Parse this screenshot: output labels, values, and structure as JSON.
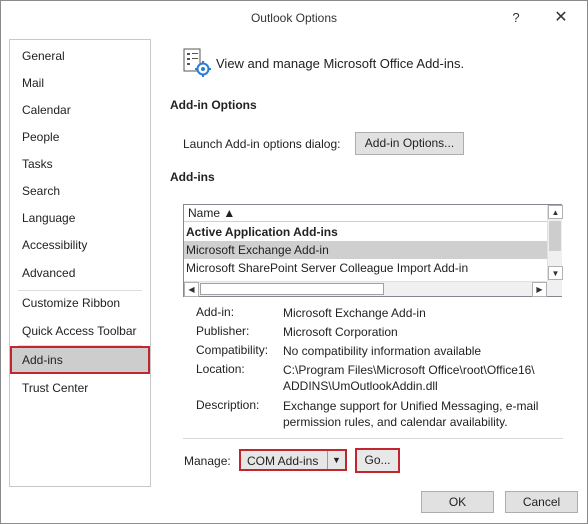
{
  "window": {
    "title": "Outlook Options",
    "help_icon": "question-mark-icon",
    "close_icon": "close-icon"
  },
  "sidebar": {
    "items": [
      {
        "label": "General"
      },
      {
        "label": "Mail"
      },
      {
        "label": "Calendar"
      },
      {
        "label": "People"
      },
      {
        "label": "Tasks"
      },
      {
        "label": "Search"
      },
      {
        "label": "Language"
      },
      {
        "label": "Accessibility"
      },
      {
        "label": "Advanced"
      },
      {
        "label": "Customize Ribbon"
      },
      {
        "label": "Quick Access Toolbar"
      },
      {
        "label": "Add-ins",
        "selected": true
      },
      {
        "label": "Trust Center"
      }
    ]
  },
  "main": {
    "header_icon": "addins-gear-icon",
    "header_text": "View and manage Microsoft Office Add-ins.",
    "addin_options": {
      "section_title": "Add-in Options",
      "launch_label": "Launch Add-in options dialog:",
      "button_label": "Add-in Options..."
    },
    "addins": {
      "section_title": "Add-ins",
      "column_header": "Name ▲",
      "rows": [
        {
          "text": "Active Application Add-ins",
          "type": "group"
        },
        {
          "text": "Microsoft Exchange Add-in",
          "type": "selected"
        },
        {
          "text": "Microsoft SharePoint Server Colleague Import Add-in",
          "type": "normal"
        }
      ]
    },
    "details": {
      "addin_label": "Add-in:",
      "addin_value": "Microsoft Exchange Add-in",
      "publisher_label": "Publisher:",
      "publisher_value": "Microsoft Corporation",
      "compat_label": "Compatibility:",
      "compat_value": "No compatibility information available",
      "location_label": "Location:",
      "location_value_1": "C:\\Program Files\\Microsoft Office\\root\\Office16\\",
      "location_value_2": "ADDINS\\UmOutlookAddin.dll",
      "description_label": "Description:",
      "description_value_1": "Exchange support for Unified Messaging, e-mail",
      "description_value_2": "permission rules, and calendar availability."
    },
    "manage": {
      "label": "Manage:",
      "selected": "COM Add-ins",
      "go_label": "Go..."
    }
  },
  "footer": {
    "ok_label": "OK",
    "cancel_label": "Cancel"
  },
  "colors": {
    "highlight_border": "#c0262d",
    "selected_bg": "#cdcdcd"
  }
}
